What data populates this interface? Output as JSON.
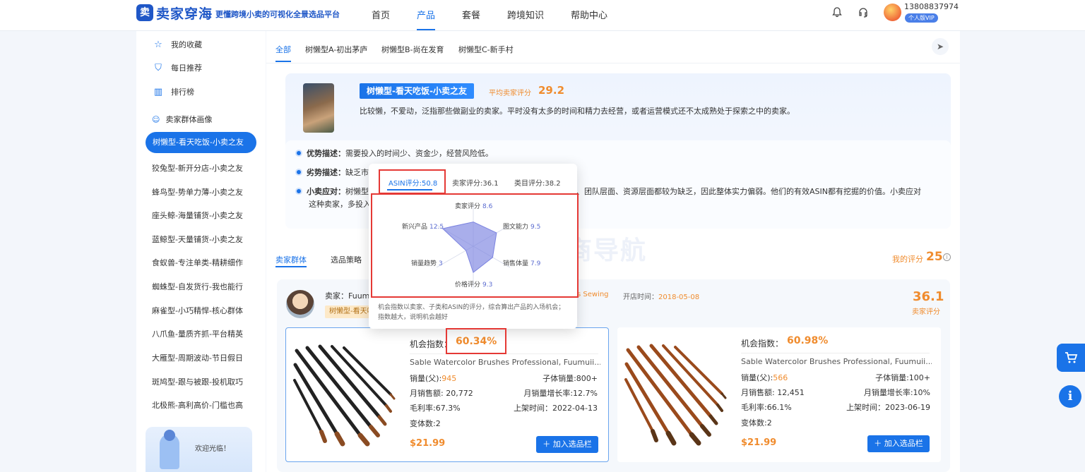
{
  "header": {
    "logo_mark": "卖",
    "logo_text": "卖家穿海",
    "slogan": "更懂跨境小卖的可视化全景选品平台",
    "nav": [
      {
        "label": "首页"
      },
      {
        "label": "产品"
      },
      {
        "label": "套餐"
      },
      {
        "label": "跨境知识"
      },
      {
        "label": "帮助中心"
      }
    ],
    "active_nav": "产品",
    "bell_icon": "bell-icon",
    "headset_icon": "headset-icon",
    "phone": "13808837974",
    "vip_badge": "个人版VIP"
  },
  "sidebar": {
    "items": [
      {
        "label": "我的收藏",
        "icon": "star-icon"
      },
      {
        "label": "每日推荐",
        "icon": "shield-icon"
      },
      {
        "label": "排行榜",
        "icon": "bar-chart-icon"
      }
    ],
    "section_label": "卖家群体画像",
    "groups": [
      "树懒型-看天吃饭-小卖之友",
      "狡兔型-新开分店-小卖之友",
      "蜂鸟型-势单力薄-小卖之友",
      "座头鲸-海量铺货-小卖之友",
      "蓝鲸型-天量铺货-小卖之友",
      "食蚁兽-专注单类-精耕细作",
      "蜘蛛型-自发货行-我也能行",
      "麻雀型-小巧精悍-核心群体",
      "八爪鱼-量质齐抓-平台精英",
      "大雁型-周期波动-节日假日",
      "斑鸠型-跟与被跟-投机取巧",
      "北极熊-高利高价-门槛也高"
    ],
    "welcome_text": "欢迎光临！"
  },
  "main": {
    "tabs": [
      "全部",
      "树懒型A-初出茅庐",
      "树懒型B-尚在发育",
      "树懒型C-新手村"
    ],
    "profile": {
      "title": "树懒型-看天吃饭-小卖之友",
      "avg_label": "平均卖家评分",
      "avg_value": "29.2",
      "desc": "比较懒，不爱动，泛指那些做副业的卖家。平时没有太多的时间和精力去经营，或者运营模式还不太成熟处于探索之中的卖家。",
      "adv_key": "优势描述：",
      "adv_val": "需要投入的时间少、资金少，经营风险低。",
      "dis_key": "劣势描述：",
      "dis_val": "缺乏市",
      "resp_key": "小卖应对：",
      "resp_val_a": "树懒型",
      "resp_val_b": "、团队层面、资源层面都较为缺乏，因此整体实力偏弱。他们的有效ASIN都有挖掘的价值。小卖应对",
      "resp_val_c": "这种卖家，多投入"
    },
    "section_tabs": [
      "卖家群体",
      "选品策略"
    ],
    "my_score_label": "我的评分",
    "my_score_value": "25",
    "seller": {
      "name": "卖家：Fuum",
      "tag": "树懒型-看天吃",
      "store": "s Sewing",
      "open_label": "开店时间：",
      "open_date": "2018-05-08",
      "score": "36.1",
      "score_label": "卖家评分"
    },
    "products": [
      {
        "k": "机会指数：",
        "v": "60.34%",
        "title": "Sable Watercolor Brushes Professional, Fuumuii...",
        "sales_label": "销量(父):",
        "sales": "945",
        "child_sales": "子体销量:800+",
        "monthly_rev": "月销售额: 20,772",
        "growth": "月销量增长率:12.7%",
        "margin": "毛利率:67.3%",
        "listed": "上架时间：2022-04-13",
        "variants": "变体数:2",
        "price": "$21.99",
        "button": "＋ 加入选品栏"
      },
      {
        "k": "机会指数：",
        "v": "60.98%",
        "title": "Sable Watercolor Brushes Professional, Fuumuii...",
        "sales_label": "销量(父):",
        "sales": "566",
        "child_sales": "子体销量:100+",
        "monthly_rev": "月销售额: 12,451",
        "growth": "月销量增长率:10%",
        "margin": "毛利率:66.1%",
        "listed": "上架时间：2023-06-19",
        "variants": "变体数:2",
        "price": "$21.99",
        "button": "＋ 加入选品栏"
      }
    ]
  },
  "popup": {
    "tabs": [
      "ASIN评分:50.8",
      "卖家评分:36.1",
      "类目评分:38.2"
    ],
    "radar": [
      {
        "label": "卖家评分",
        "value": 8.6
      },
      {
        "label": "图文能力",
        "value": 9.5
      },
      {
        "label": "销售体量",
        "value": 7.9
      },
      {
        "label": "价格评分",
        "value": 9.3
      },
      {
        "label": "销量趋势",
        "value": 3
      },
      {
        "label": "新兴产品",
        "value": 12.5
      }
    ],
    "radar_max": 15,
    "radar_color": "#7b83e0",
    "note": "机会指数以卖家、子类和ASIN的评分，综合算出产品的入场机会；指数越大，说明机会越好"
  },
  "watermark": "树懒跨境电商导航",
  "floating": {
    "cart_icon": "cart-icon",
    "info_icon": "info-icon",
    "info_glyph": "i"
  }
}
